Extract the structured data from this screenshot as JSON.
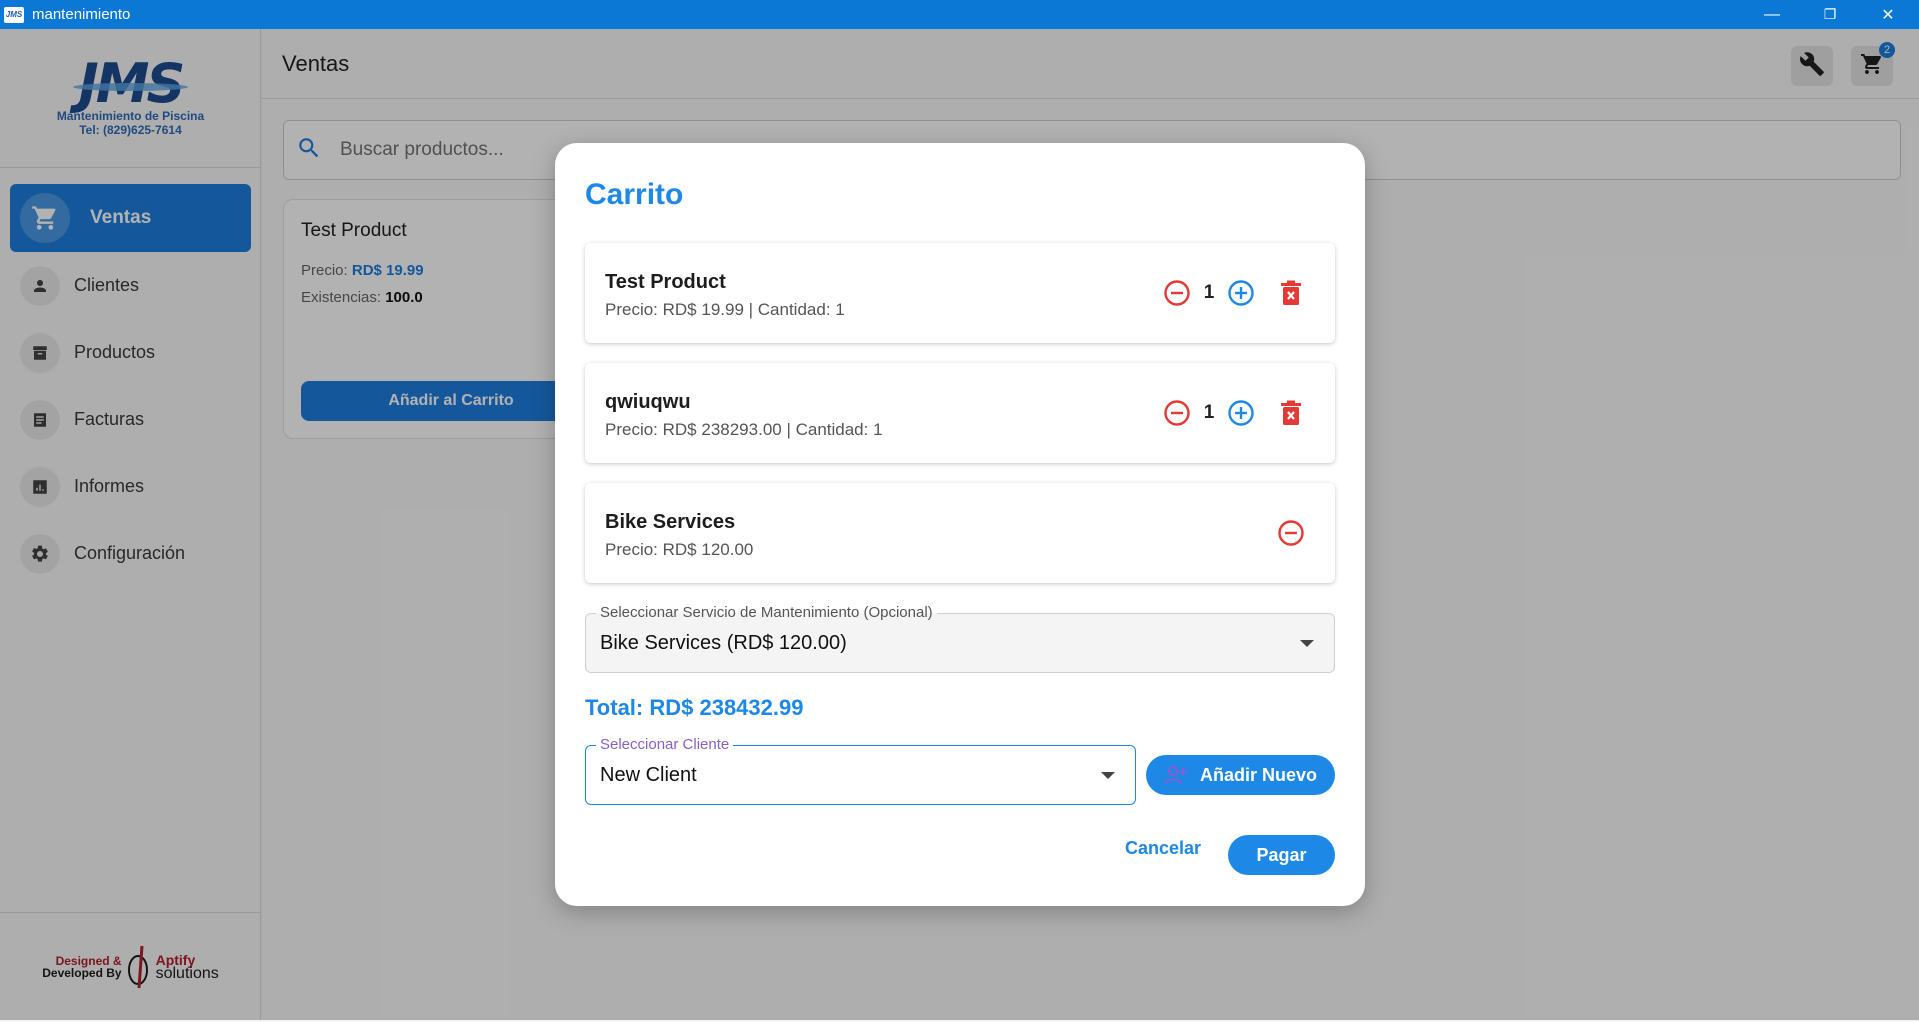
{
  "window": {
    "title": "mantenimiento",
    "app_icon_text": "JMS",
    "minimize": "—",
    "restore": "❐",
    "close": "✕"
  },
  "sidebar": {
    "logo": {
      "mark": "JMS",
      "line1": "Mantenimiento de Piscina",
      "line2": "Tel: (829)625-7614"
    },
    "items": [
      {
        "label": "Ventas",
        "icon": "shopping-cart-icon",
        "active": true
      },
      {
        "label": "Clientes",
        "icon": "person-icon",
        "active": false
      },
      {
        "label": "Productos",
        "icon": "archive-box-icon",
        "active": false
      },
      {
        "label": "Facturas",
        "icon": "receipt-list-icon",
        "active": false
      },
      {
        "label": "Informes",
        "icon": "bar-chart-icon",
        "active": false
      },
      {
        "label": "Configuración",
        "icon": "gear-icon",
        "active": false
      }
    ],
    "footer": {
      "designed": "Designed &",
      "developed": "Developed By",
      "brand1": "Aptify",
      "brand2": "solutions"
    }
  },
  "header": {
    "title": "Ventas",
    "cart_count": "2"
  },
  "search": {
    "placeholder": "Buscar productos..."
  },
  "product_card": {
    "name": "Test Product",
    "price_label": "Precio:",
    "price_value": "RD$ 19.99",
    "stock_label": "Existencias:",
    "stock_value": "100.0",
    "add_button": "Añadir al Carrito"
  },
  "dialog": {
    "title": "Carrito",
    "items": [
      {
        "name": "Test Product",
        "detail": "Precio: RD$ 19.99 | Cantidad: 1",
        "qty": "1"
      },
      {
        "name": "qwiuqwu",
        "detail": "Precio: RD$ 238293.00 | Cantidad: 1",
        "qty": "1"
      },
      {
        "name": "Bike Services",
        "detail": "Precio: RD$ 120.00"
      }
    ],
    "service_select": {
      "label": "Seleccionar Servicio de Mantenimiento (Opcional)",
      "value": "Bike Services (RD$ 120.00)"
    },
    "total": "Total: RD$ 238432.99",
    "client_select": {
      "label": "Seleccionar Cliente",
      "value": "New Client"
    },
    "add_new": "Añadir Nuevo",
    "cancel": "Cancelar",
    "pay": "Pagar"
  },
  "colors": {
    "accent": "#1d88e5",
    "nav_active": "#1d7fdf",
    "danger": "#e53935",
    "titlebar": "#0a78d4"
  }
}
